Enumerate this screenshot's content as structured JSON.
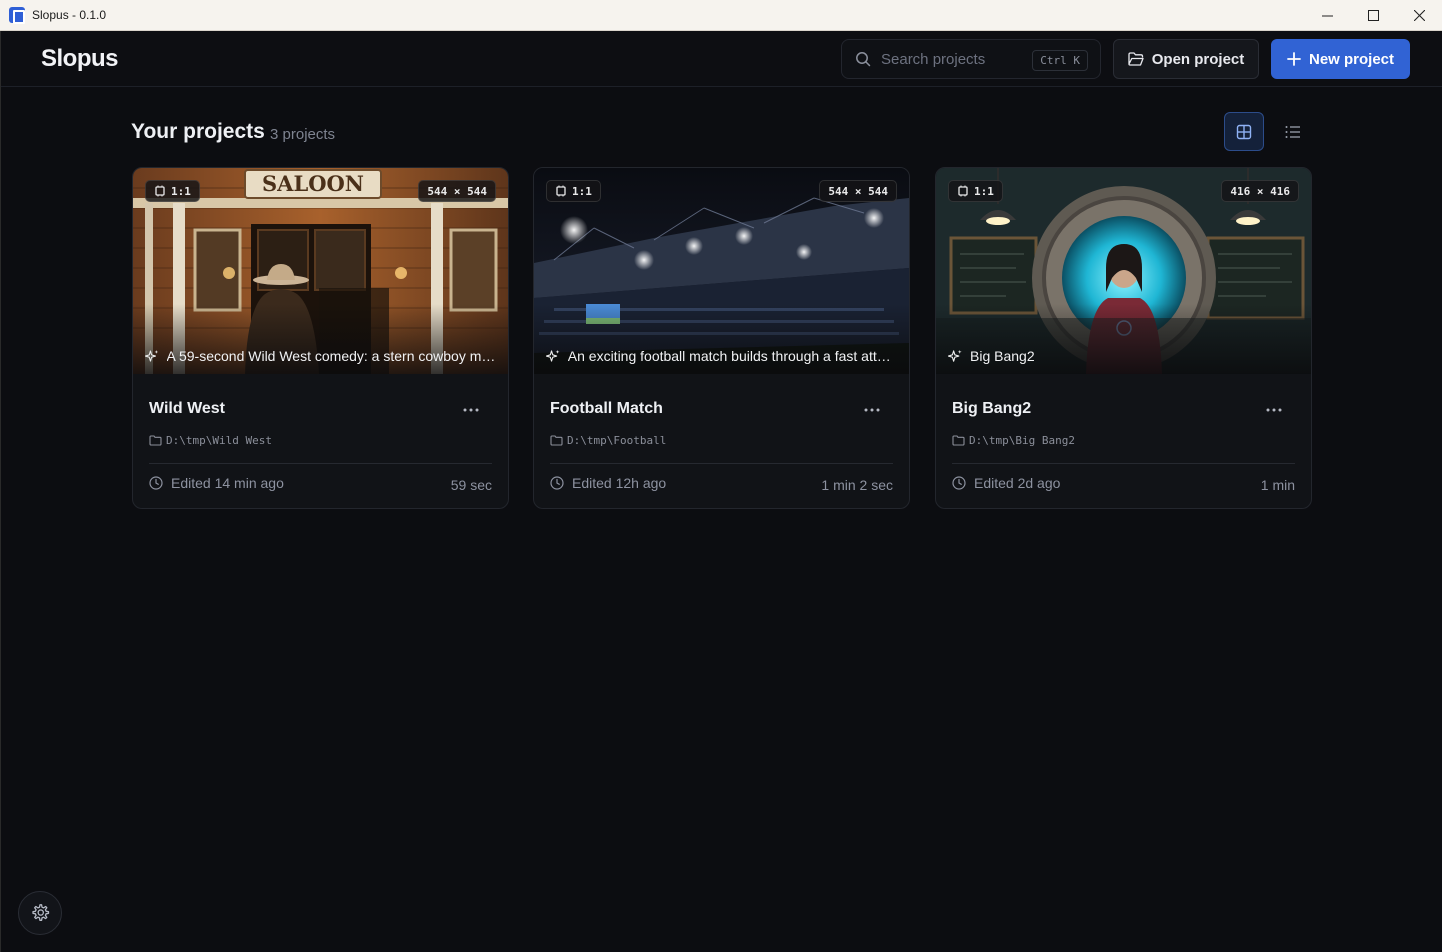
{
  "window": {
    "title": "Slopus - 0.1.0"
  },
  "header": {
    "brand": "Slopus",
    "search_placeholder": "Search projects",
    "search_shortcut": "Ctrl K",
    "open_project_label": "Open project",
    "new_project_label": "New project"
  },
  "projects_section": {
    "title": "Your projects",
    "count_label": "3 projects",
    "view_mode": "grid"
  },
  "projects": [
    {
      "name": "Wild West",
      "aspect_ratio": "1:1",
      "resolution": "544 × 544",
      "prompt": "A 59-second Wild West comedy: a stern cowboy mak...",
      "path": "D:\\tmp\\Wild West",
      "edited": "Edited 14 min ago",
      "duration": "59 sec",
      "sign_text": "SALOON"
    },
    {
      "name": "Football Match",
      "aspect_ratio": "1:1",
      "resolution": "544 × 544",
      "prompt": "An exciting football match builds through a fast attac...",
      "path": "D:\\tmp\\Football",
      "edited": "Edited 12h ago",
      "duration": "1 min 2 sec"
    },
    {
      "name": "Big Bang2",
      "aspect_ratio": "1:1",
      "resolution": "416 × 416",
      "prompt": "Big Bang2",
      "path": "D:\\tmp\\Big Bang2",
      "edited": "Edited 2d ago",
      "duration": "1 min"
    }
  ],
  "colors": {
    "background": "#0c0d11",
    "accent": "#3163d4",
    "card": "#111317"
  }
}
